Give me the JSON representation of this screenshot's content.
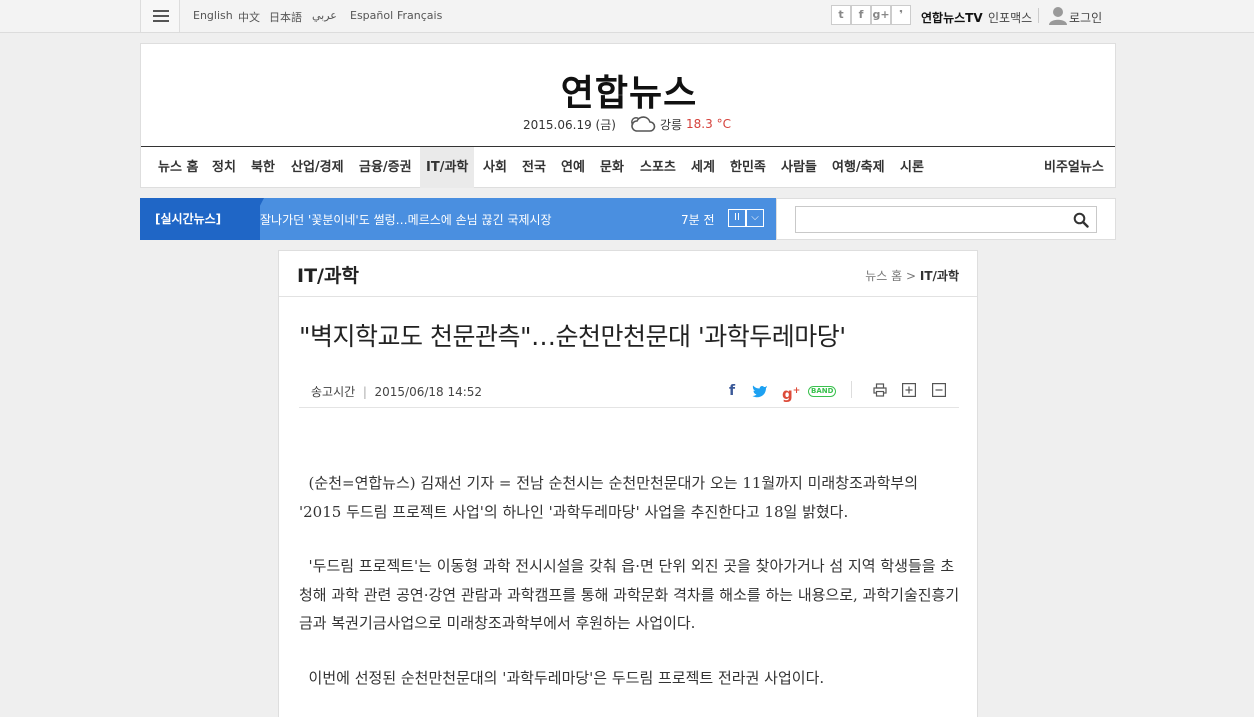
{
  "topbar": {
    "languages": [
      "English",
      "中文",
      "日本語",
      "عربي",
      "Español",
      "Français"
    ],
    "social": [
      {
        "icon": "twitter-icon",
        "glyph": "t"
      },
      {
        "icon": "facebook-icon",
        "glyph": "f"
      },
      {
        "icon": "google-plus-icon",
        "glyph": "g+"
      },
      {
        "icon": "story-icon",
        "glyph": "❜"
      }
    ],
    "tv_label": "연합뉴스TV",
    "infomax_label": "인포맥스",
    "login_label": "로그인"
  },
  "header": {
    "logo": "연합뉴스",
    "date": "2015.06.19 (금)",
    "weather_icon": "cloud-icon",
    "city": "강릉",
    "temperature": "18.3 °C",
    "nav": [
      "뉴스 홈",
      "정치",
      "북한",
      "산업/경제",
      "금융/증권",
      "IT/과학",
      "사회",
      "전국",
      "연예",
      "문화",
      "스포츠",
      "세계",
      "한민족",
      "사람들",
      "여행/축제",
      "시론"
    ],
    "nav_active": "IT/과학",
    "nav_right": "비주얼뉴스"
  },
  "ticker": {
    "label": "[실시간뉴스]",
    "headline": "잘나가던 '꽃분이네'도 썰렁…메르스에 손님 끊긴 국제시장",
    "time": "7분 전",
    "pause_glyph": "II",
    "more_glyph": "⌵"
  },
  "search": {
    "placeholder": "",
    "icon": "search-icon"
  },
  "article": {
    "section": "IT/과학",
    "breadcrumb_home": "뉴스 홈",
    "breadcrumb_sep": ">",
    "breadcrumb_current": "IT/과학",
    "headline": "\"벽지학교도 천문관측\"…순천만천문대 '과학두레마당'",
    "sent_label": "송고시간",
    "sent_time": "2015/06/18 14:52",
    "band_label": "BAND",
    "paragraphs": [
      "(순천=연합뉴스) 김재선 기자 = 전남 순천시는 순천만천문대가 오는 11월까지 미래창조과학부의 '2015 두드림 프로젝트 사업'의 하나인 '과학두레마당' 사업을 추진한다고 18일 밝혔다.",
      "'두드림 프로젝트'는 이동형 과학 전시시설을 갖춰 읍·면 단위 외진 곳을 찾아가거나 섬 지역 학생들을 초청해 과학 관련 공연·강연 관람과 과학캠프를 통해 과학문화 격차를 해소를 하는 내용으로, 과학기술진흥기금과 복권기금사업으로 미래창조과학부에서 후원하는 사업이다.",
      "이번에 선정된 순천만천문대의 '과학두레마당'은 두드림 프로젝트 전라권 사업이다."
    ]
  }
}
